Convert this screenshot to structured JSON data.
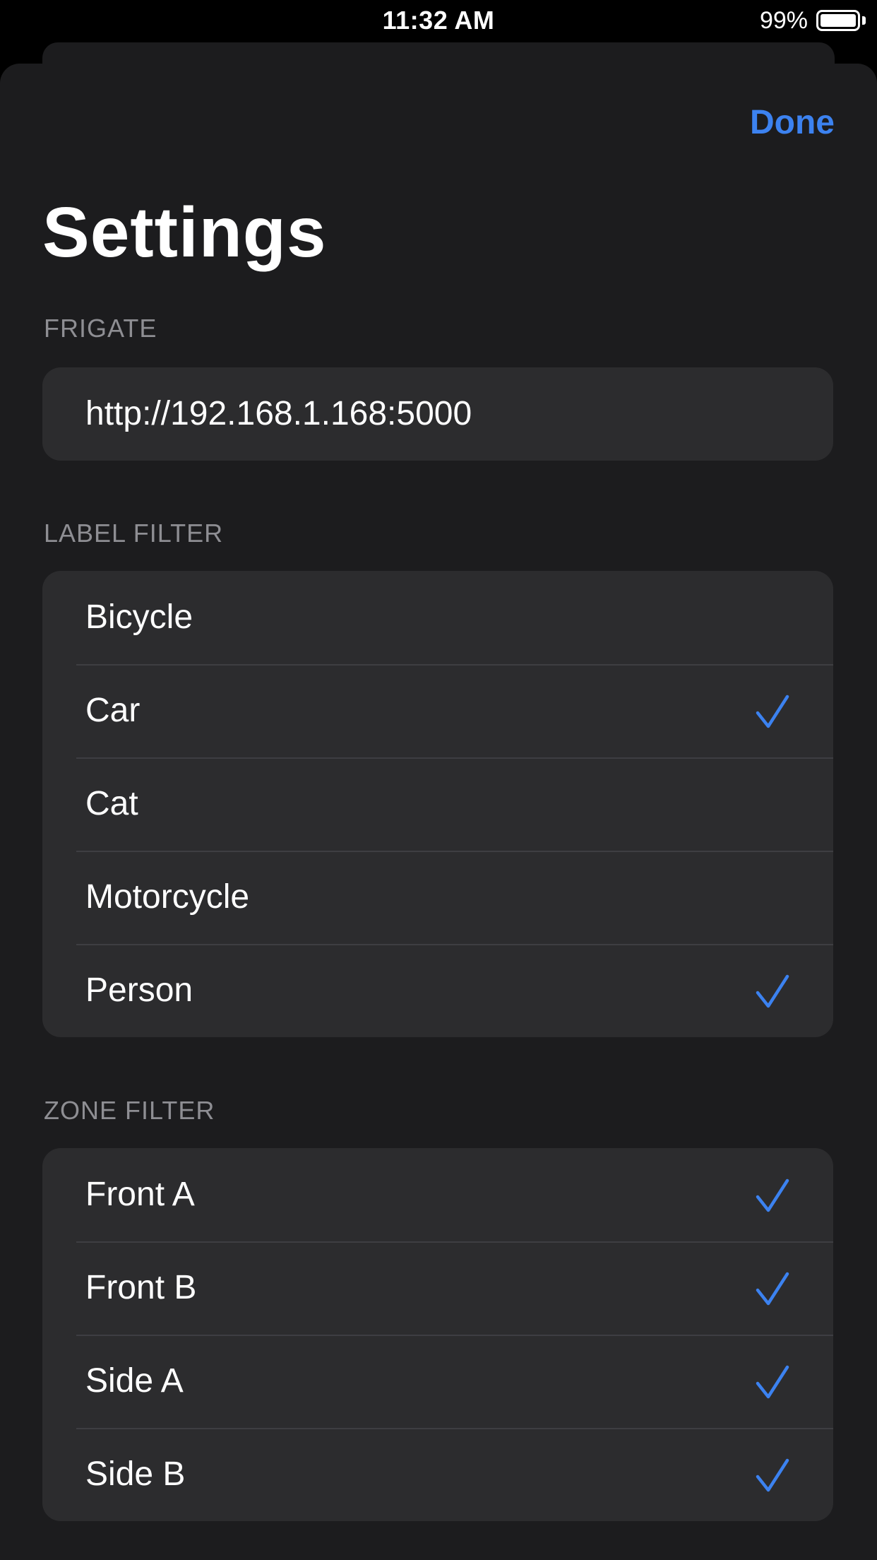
{
  "status_bar": {
    "time": "11:32 AM",
    "battery_percent": "99%",
    "battery_level": 0.99
  },
  "nav": {
    "done_label": "Done"
  },
  "page_title": "Settings",
  "frigate": {
    "header": "FRIGATE",
    "url_value": "http://192.168.1.168:5000"
  },
  "label_filter": {
    "header": "LABEL FILTER",
    "items": [
      {
        "label": "Bicycle",
        "checked": false
      },
      {
        "label": "Car",
        "checked": true
      },
      {
        "label": "Cat",
        "checked": false
      },
      {
        "label": "Motorcycle",
        "checked": false
      },
      {
        "label": "Person",
        "checked": true
      }
    ]
  },
  "zone_filter": {
    "header": "ZONE FILTER",
    "items": [
      {
        "label": "Front A",
        "checked": true
      },
      {
        "label": "Front B",
        "checked": true
      },
      {
        "label": "Side A",
        "checked": true
      },
      {
        "label": "Side B",
        "checked": true
      }
    ]
  },
  "colors": {
    "accent": "#3c82f0",
    "background": "#1c1c1e",
    "cell": "#2c2c2e",
    "secondary_text": "#8e8e93"
  },
  "icons": {
    "checkmark": "checkmark-icon",
    "battery": "battery-icon"
  }
}
